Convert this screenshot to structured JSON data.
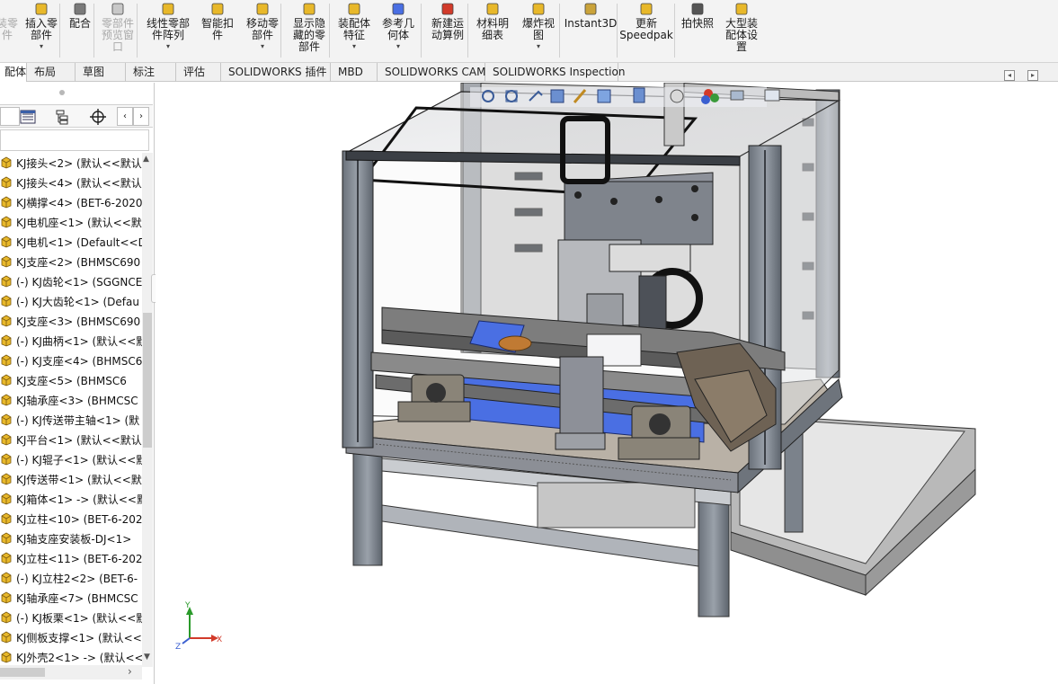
{
  "ribbon": {
    "items": [
      {
        "label": "插入零\n部件",
        "icon": "insert-component-icon",
        "caret": true,
        "disabled": false
      },
      {
        "label": "配合",
        "icon": "mate-paperclip-icon",
        "caret": false,
        "disabled": false
      },
      {
        "label": "零部件\n预览窗\n口",
        "icon": "component-preview-icon",
        "caret": false,
        "disabled": true
      },
      {
        "label": "线性零部\n件阵列",
        "icon": "linear-pattern-icon",
        "caret": true,
        "disabled": false
      },
      {
        "label": "智能扣\n件",
        "icon": "smart-fasteners-icon",
        "caret": false,
        "disabled": false
      },
      {
        "label": "移动零\n部件",
        "icon": "move-component-icon",
        "caret": true,
        "disabled": false
      },
      {
        "label": "显示隐\n藏的零\n部件",
        "icon": "show-hidden-icon",
        "caret": false,
        "disabled": false
      },
      {
        "label": "装配体\n特征",
        "icon": "assembly-features-icon",
        "caret": true,
        "disabled": false
      },
      {
        "label": "参考几\n何体",
        "icon": "reference-geometry-icon",
        "caret": true,
        "disabled": false
      },
      {
        "label": "新建运\n动算例",
        "icon": "motion-study-icon",
        "caret": false,
        "disabled": false
      },
      {
        "label": "材料明\n细表",
        "icon": "bom-icon",
        "caret": false,
        "disabled": false
      },
      {
        "label": "爆炸视\n图",
        "icon": "exploded-view-icon",
        "caret": true,
        "disabled": false
      },
      {
        "label": "Instant3D",
        "icon": "instant3d-icon",
        "caret": false,
        "disabled": false
      },
      {
        "label": "更新\nSpeedpak",
        "icon": "speedpak-icon",
        "caret": false,
        "disabled": false
      },
      {
        "label": "拍快照",
        "icon": "snapshot-camera-icon",
        "caret": false,
        "disabled": false
      },
      {
        "label": "大型装\n配体设\n置",
        "icon": "large-assembly-icon",
        "caret": false,
        "disabled": false
      }
    ],
    "clipped_first_label": "装零\n件"
  },
  "tabs": [
    {
      "label": "配体",
      "active": true
    },
    {
      "label": "布局",
      "active": false
    },
    {
      "label": "草图",
      "active": false
    },
    {
      "label": "标注",
      "active": false
    },
    {
      "label": "评估",
      "active": false
    },
    {
      "label": "SOLIDWORKS 插件",
      "active": false
    },
    {
      "label": "MBD",
      "active": false
    },
    {
      "label": "SOLIDWORKS CAM",
      "active": false
    },
    {
      "label": "SOLIDWORKS Inspection",
      "active": false
    }
  ],
  "tree": {
    "items": [
      {
        "label": "KJ接头<2> (默认<<默认"
      },
      {
        "label": "KJ接头<4> (默认<<默认"
      },
      {
        "label": "KJ横撑<4> (BET-6-2020"
      },
      {
        "label": "KJ电机座<1> (默认<<默"
      },
      {
        "label": "KJ电机<1> (Default<<D"
      },
      {
        "label": "KJ支座<2> (BHMSC690"
      },
      {
        "label": "(-) KJ齿轮<1> (SGGNCE"
      },
      {
        "label": "(-) KJ大齿轮<1> (Defau"
      },
      {
        "label": "KJ支座<3> (BHMSC690"
      },
      {
        "label": "(-) KJ曲柄<1> (默认<<默"
      },
      {
        "label": "(-) KJ支座<4> (BHMSC6"
      },
      {
        "label": "KJ支座<5> (BHMSC6"
      },
      {
        "label": "KJ轴承座<3> (BHMCSC"
      },
      {
        "label": "(-) KJ传送带主轴<1> (默"
      },
      {
        "label": "KJ平台<1> (默认<<默认"
      },
      {
        "label": "(-) KJ辊子<1> (默认<<默"
      },
      {
        "label": "KJ传送带<1> (默认<<默"
      },
      {
        "label": "KJ箱体<1> -> (默认<<默"
      },
      {
        "label": "KJ立柱<10> (BET-6-202"
      },
      {
        "label": "KJ轴支座安装板-DJ<1>"
      },
      {
        "label": "KJ立柱<11> (BET-6-202"
      },
      {
        "label": "(-) KJ立柱2<2> (BET-6-"
      },
      {
        "label": "KJ轴承座<7> (BHMCSC"
      },
      {
        "label": "(-) KJ板栗<1> (默认<<默"
      },
      {
        "label": "KJ侧板支撑<1> (默认<<"
      },
      {
        "label": "KJ外壳2<1> -> (默认<<"
      }
    ]
  },
  "triad": {
    "x_label": "X",
    "y_label": "Y",
    "z_label": "Z"
  },
  "colors": {
    "part_yellow": "#e8b82a",
    "conveyor_blue": "#4a6fe3",
    "frame_gray": "#8a8f98",
    "accent_red": "#d23a2a"
  }
}
